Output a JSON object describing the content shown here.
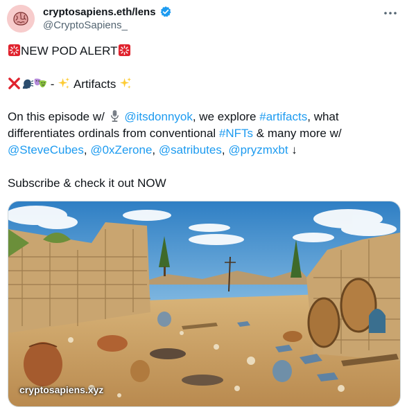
{
  "author": {
    "display_name": "cryptosapiens.eth/lens",
    "handle": "@CryptoSapiens_"
  },
  "post": {
    "line1": "NEW POD ALERT",
    "line2_text": "Artifacts",
    "line3_a": "On this episode w/",
    "line3_mention": "@itsdonnyok",
    "line3_b": ", we explore",
    "line3_tag": "#artifacts",
    "line3_c": ", what",
    "line4_a": "differentiates ordinals from conventional",
    "line4_tag": "#NFTs",
    "line4_b": "& many more w/",
    "line5_m1": "@SteveCubes",
    "line5_sep1": ",",
    "line5_m2": "@0xZerone",
    "line5_sep2": ",",
    "line5_m3": "@satributes",
    "line5_sep3": ",",
    "line5_m4": "@pryzmxbt",
    "line5_arrow": "↓",
    "line6": "Subscribe & check it out NOW"
  },
  "media": {
    "caption": "cryptosapiens.xyz"
  },
  "icons": {
    "siren": "police-light-emoji",
    "cross": "cross-mark-emoji",
    "speaking": "speaking-head-emoji",
    "masks": "performing-arts-emoji",
    "sparkles": "sparkles-emoji",
    "mic": "studio-microphone-emoji",
    "verified": "verified-badge-icon",
    "more": "more-options-icon"
  },
  "colors": {
    "link": "#1d9bf0",
    "text": "#0f1419",
    "secondary": "#536471"
  }
}
